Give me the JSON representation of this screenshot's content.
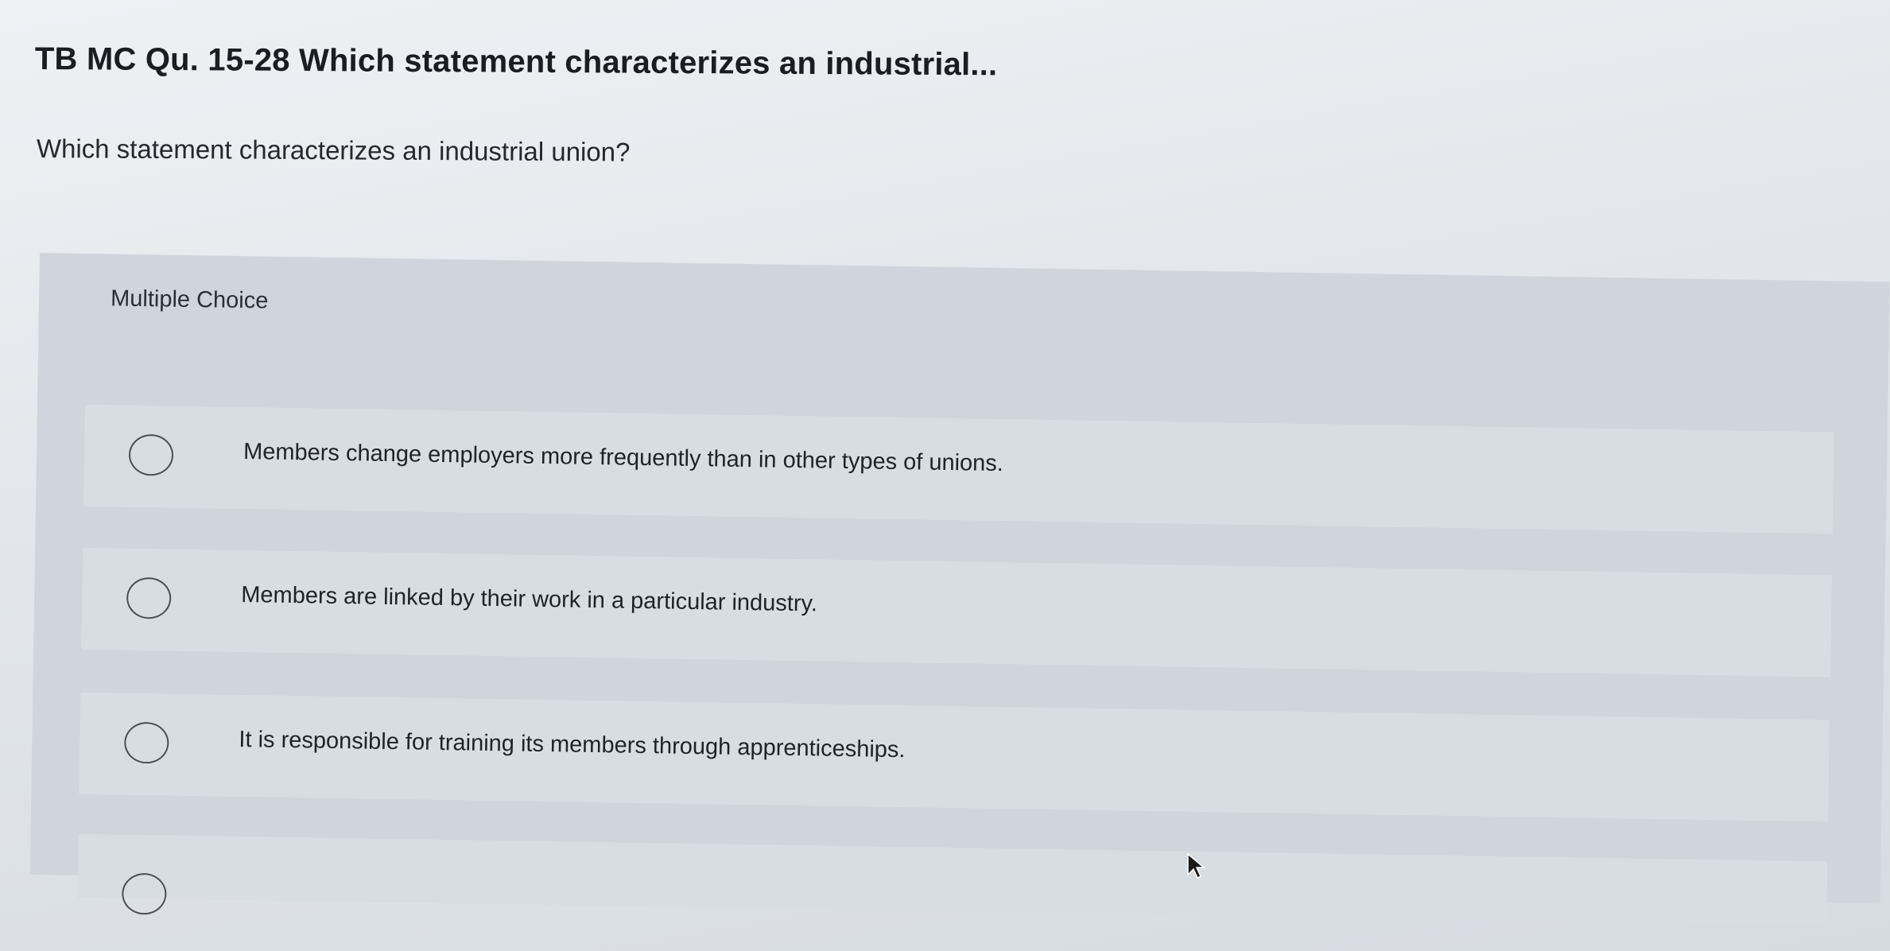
{
  "question": {
    "title": "TB MC Qu. 15-28 Which statement characterizes an industrial...",
    "text": "Which statement characterizes an industrial union?"
  },
  "choices": {
    "section_label": "Multiple Choice",
    "options": [
      {
        "label": "Members change employers more frequently than in other types of unions."
      },
      {
        "label": "Members are linked by their work in a particular industry."
      },
      {
        "label": "It is responsible for training its members through apprenticeships."
      },
      {
        "label": ""
      }
    ]
  },
  "icons": {
    "radio": "radio-button-unchecked-icon",
    "cursor": "mouse-pointer-icon"
  },
  "colors": {
    "panel": "#cfd5db",
    "option_row": "#d8dde2",
    "text": "#1f2328"
  }
}
